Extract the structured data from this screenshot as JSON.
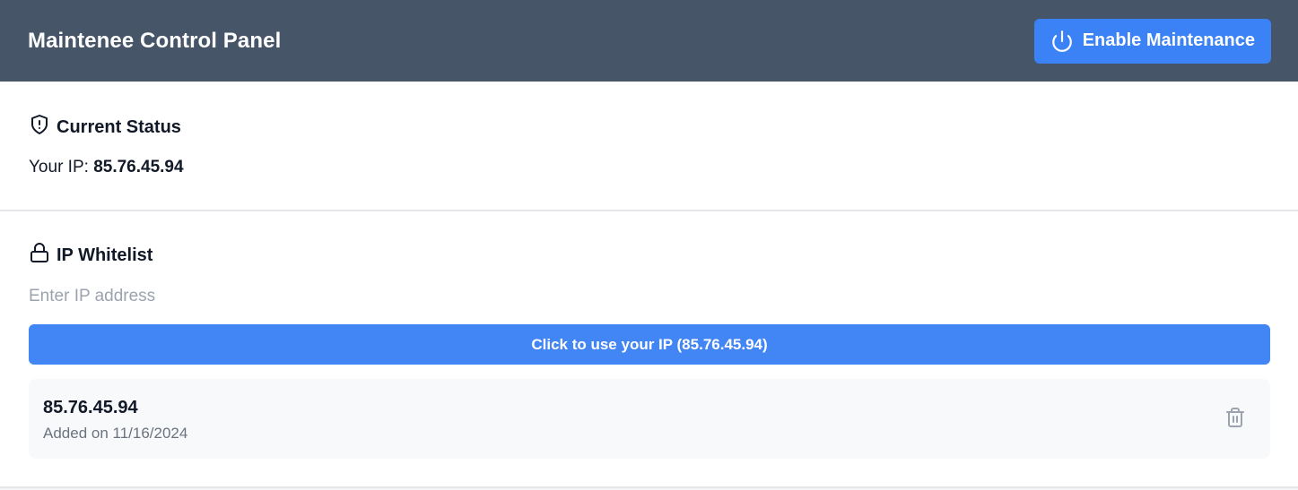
{
  "header": {
    "title": "Maintenee Control Panel",
    "maintenance_button_label": "Enable Maintenance",
    "maintenance_button_icon": "power-icon"
  },
  "status": {
    "title": "Current Status",
    "icon": "shield-alert-icon",
    "ip_label": "Your IP:",
    "ip_value": "85.76.45.94"
  },
  "whitelist": {
    "title": "IP Whitelist",
    "icon": "lock-icon",
    "input_value": "",
    "input_placeholder": "Enter IP address",
    "use_ip_button_label": "Click to use your IP (85.76.45.94)",
    "items": [
      {
        "ip": "85.76.45.94",
        "added": "Added on 11/16/2024",
        "delete_icon": "trash-icon"
      }
    ]
  },
  "colors": {
    "header_bg": "#475569",
    "accent": "#3b82f6",
    "page_bg": "#f3f4f6",
    "item_bg": "#f8f9fb"
  }
}
